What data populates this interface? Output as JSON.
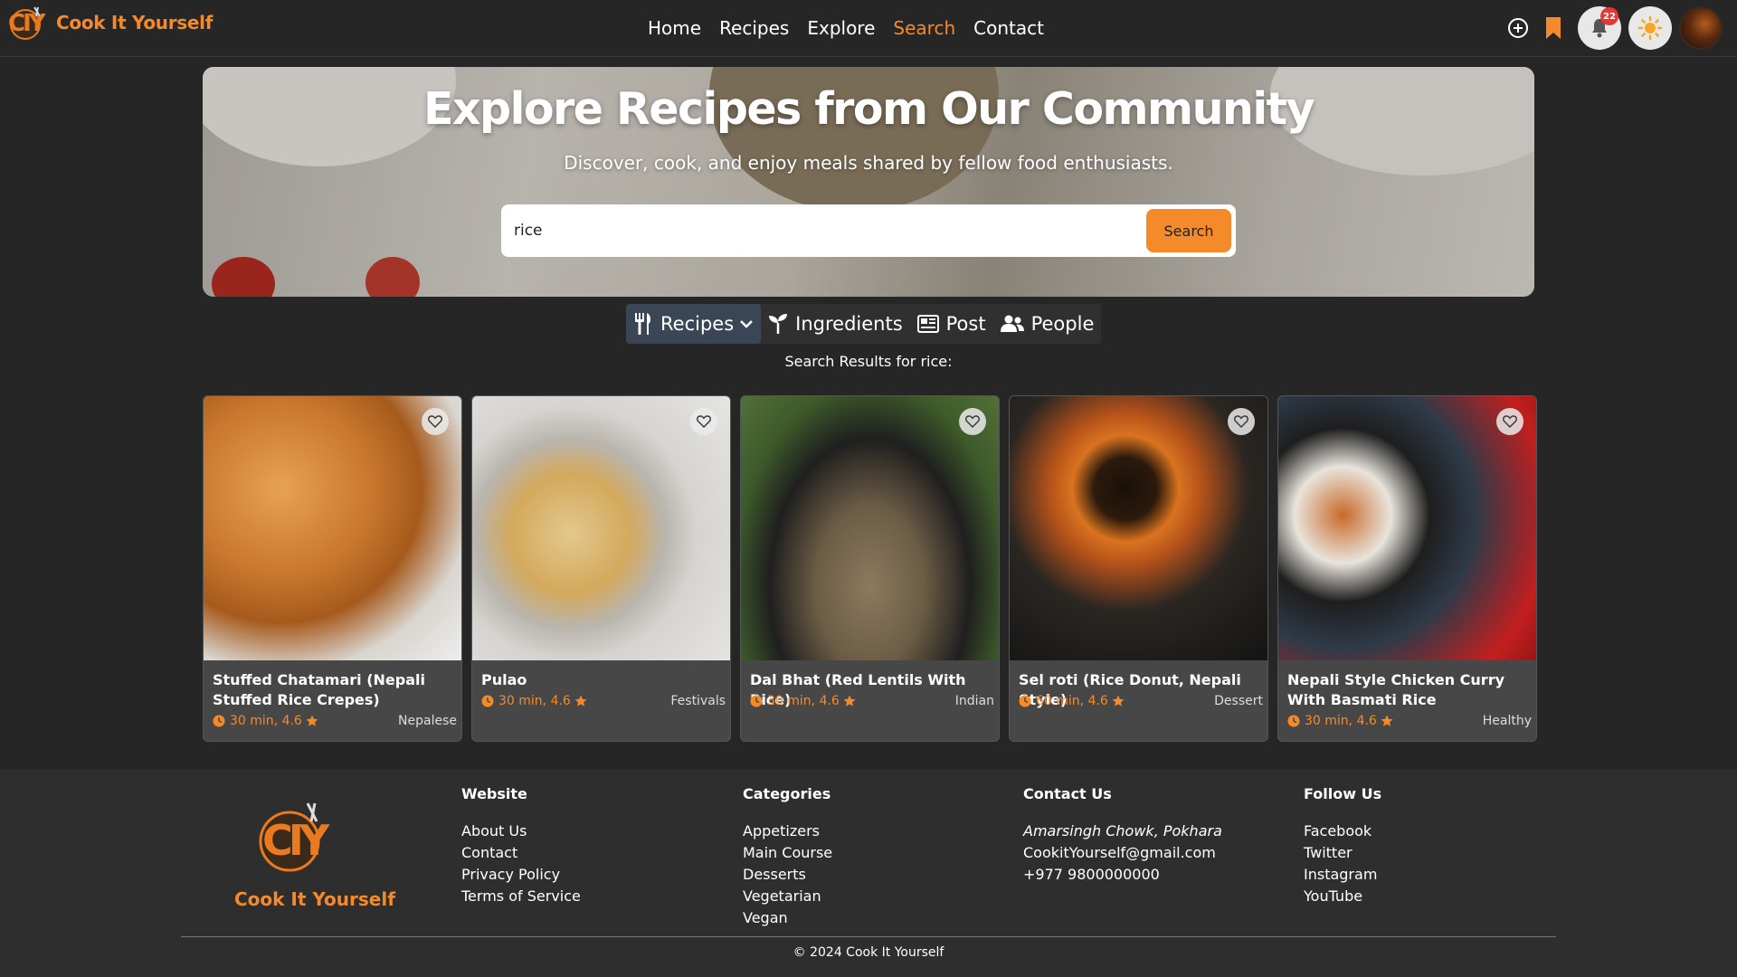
{
  "brand": {
    "name": "Cook It Yourself",
    "logo_text": "CIY",
    "accent": "#f58a2a"
  },
  "nav": {
    "links": [
      {
        "label": "Home",
        "active": false
      },
      {
        "label": "Recipes",
        "active": false
      },
      {
        "label": "Explore",
        "active": false
      },
      {
        "label": "Search",
        "active": true
      },
      {
        "label": "Contact",
        "active": false
      }
    ],
    "icons": [
      "add-circle-icon",
      "bookmark-icon",
      "bell-icon",
      "sun-icon"
    ],
    "notification_count": "22"
  },
  "hero": {
    "title": "Explore Recipes from Our Community",
    "subtitle": "Discover, cook, and enjoy meals shared by fellow food enthusiasts.",
    "search_value": "rice",
    "search_button": "Search"
  },
  "tabs": [
    {
      "label": "Recipes",
      "icon": "utensils-icon",
      "active": true,
      "dropdown": true
    },
    {
      "label": "Ingredients",
      "icon": "seedling-icon",
      "active": false
    },
    {
      "label": "Post",
      "icon": "newspaper-icon",
      "active": false
    },
    {
      "label": "People",
      "icon": "users-icon",
      "active": false
    }
  ],
  "results_label": "Search Results for rice:",
  "recipes": [
    {
      "title": "Stuffed Chatamari (Nepali Stuffed Rice Crepes)",
      "meta": "30 min, 4.6",
      "category": "Nepalese"
    },
    {
      "title": "Pulao",
      "meta": "30 min, 4.6",
      "category": "Festivals"
    },
    {
      "title": "Dal Bhat (Red Lentils With Rice)",
      "meta": "30 min, 4.6",
      "category": "Indian"
    },
    {
      "title": "Sel roti (Rice Donut, Nepali Style)",
      "meta": "60 min, 4.6",
      "category": "Dessert"
    },
    {
      "title": "Nepali Style Chicken Curry With Basmati Rice",
      "meta": "30 min, 4.6",
      "category": "Healthy"
    }
  ],
  "footer": {
    "brand": "Cook It Yourself",
    "website": {
      "heading": "Website",
      "items": [
        "About Us",
        "Contact",
        "Privacy Policy",
        "Terms of Service"
      ]
    },
    "categories": {
      "heading": "Categories",
      "items": [
        "Appetizers",
        "Main Course",
        "Desserts",
        "Vegetarian",
        "Vegan"
      ]
    },
    "contact": {
      "heading": "Contact Us",
      "address": "Amarsingh Chowk, Pokhara",
      "email": "CookitYourself@gmail.com",
      "phone": "+977 9800000000"
    },
    "follow": {
      "heading": "Follow Us",
      "items": [
        "Facebook",
        "Twitter",
        "Instagram",
        "YouTube"
      ]
    },
    "copyright": "© 2024 Cook It Yourself"
  }
}
